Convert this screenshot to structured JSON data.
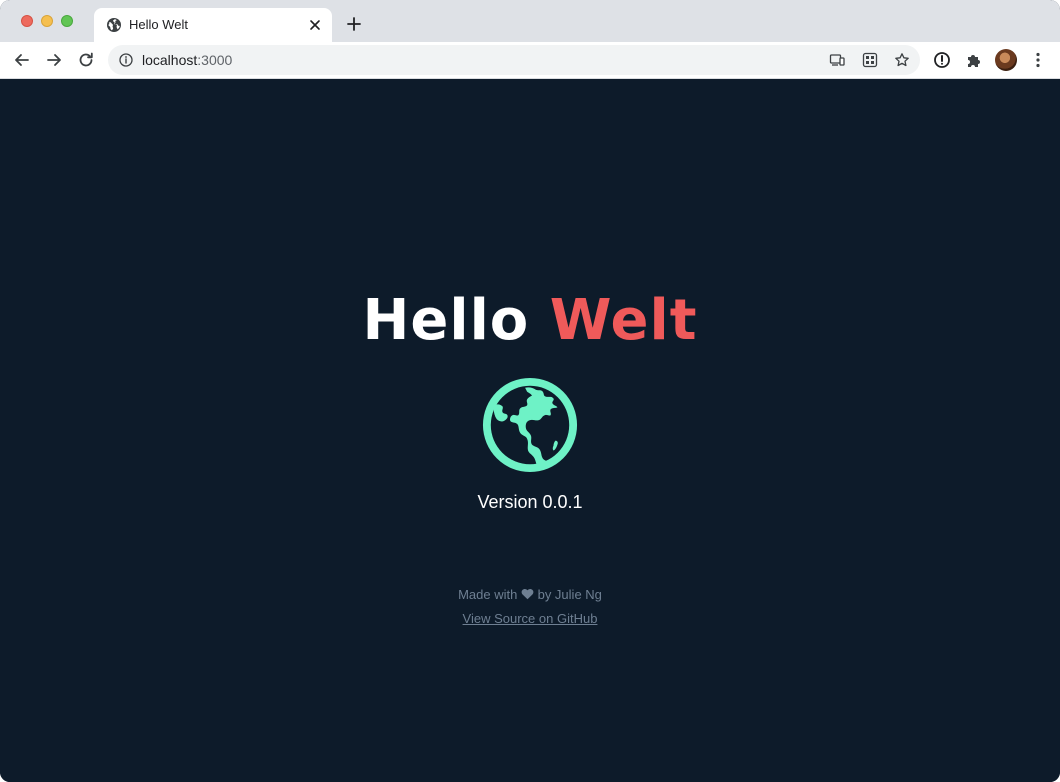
{
  "browser": {
    "tab_title": "Hello Welt",
    "url_host": "localhost",
    "url_port": ":3000",
    "icons": {
      "favicon": "globe-icon",
      "tab_close": "close-icon",
      "new_tab": "plus-icon",
      "back": "arrow-left-icon",
      "forward": "arrow-right-icon",
      "reload": "reload-icon",
      "site_info": "info-icon",
      "cast": "cast-icon",
      "qr": "qr-code-icon",
      "bookmark": "star-icon",
      "password": "password-icon",
      "extensions": "puzzle-icon",
      "menu": "kebab-menu-icon"
    }
  },
  "page": {
    "headline_word1": "Hello",
    "headline_word2": "Welt",
    "version": "Version 0.0.1",
    "footer_made_with": "Made with",
    "footer_by": "by Julie Ng",
    "source_link": "View Source on GitHub",
    "colors": {
      "background": "#0d1b2a",
      "accent": "#ef5a5a",
      "globe": "#6ef2c6",
      "muted": "#6e7f92"
    }
  }
}
